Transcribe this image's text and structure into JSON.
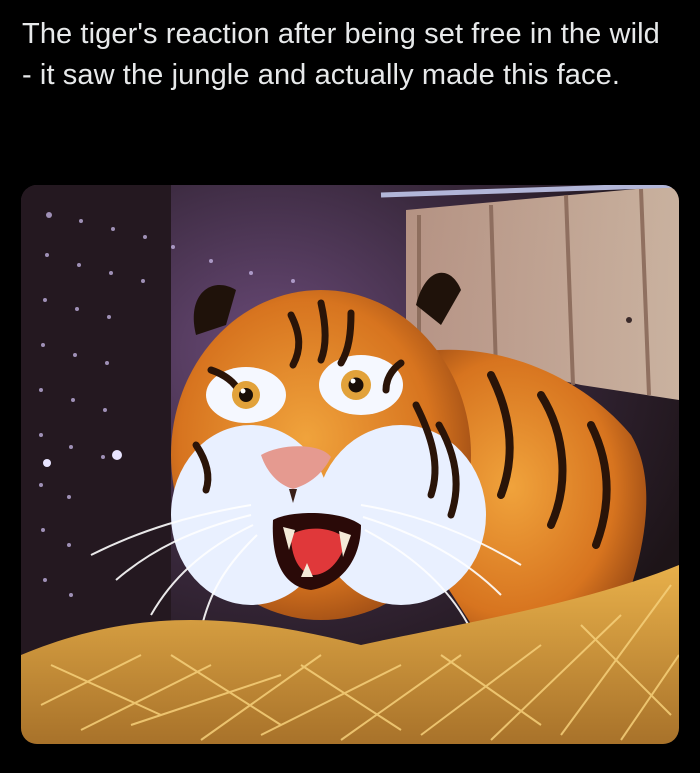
{
  "post": {
    "text": "The tiger's reaction after being set free in the wild - it saw the jungle and actually made this face."
  },
  "media": {
    "subject": "tiger-photo"
  },
  "colors": {
    "background": "#000000",
    "text": "#e7e9ea"
  }
}
